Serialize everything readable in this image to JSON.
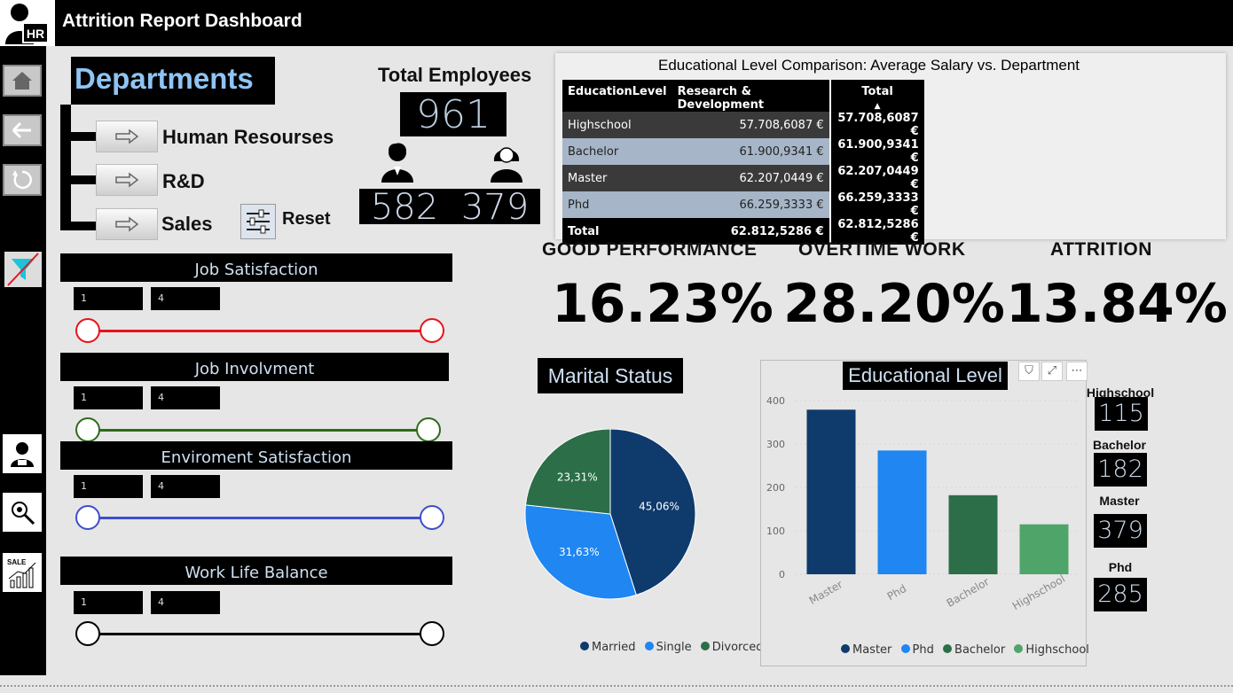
{
  "header": {
    "title": "Attrition Report Dashboard",
    "logo_text": "HR"
  },
  "nav": {
    "items": [
      "home-icon",
      "back-arrow-icon",
      "refresh-icon",
      "clear-filter-icon",
      "employee-icon",
      "hr-analysis-icon",
      "sales-chart-icon"
    ]
  },
  "departments": {
    "title": "Departments",
    "items": [
      "Human Resourses",
      "R&D",
      "Sales"
    ],
    "reset_label": "Reset"
  },
  "employees": {
    "title": "Total Employees",
    "total": "961",
    "male": "582",
    "female": "379"
  },
  "salary_table": {
    "title": "Educational Level Comparison: Average Salary vs. Department",
    "headers": [
      "EducationLevel",
      "Research & Development",
      "Total"
    ],
    "rows": [
      {
        "level": "Highschool",
        "rd": "57.708,6087 €",
        "total": "57.708,6087 €"
      },
      {
        "level": "Bachelor",
        "rd": "61.900,9341 €",
        "total": "61.900,9341 €"
      },
      {
        "level": "Master",
        "rd": "62.207,0449 €",
        "total": "62.207,0449 €"
      },
      {
        "level": "Phd",
        "rd": "66.259,3333 €",
        "total": "66.259,3333 €"
      }
    ],
    "total_row": {
      "label": "Total",
      "rd": "62.812,5286 €",
      "total": "62.812,5286 €"
    }
  },
  "kpis": [
    {
      "label": "GOOD PERFORMANCE",
      "value": "16.23%"
    },
    {
      "label": "OVERTIME WORK",
      "value": "28.20%"
    },
    {
      "label": "ATTRITION",
      "value": "13.84%"
    }
  ],
  "slicers": [
    {
      "title": "Job Satisfaction",
      "min": "1",
      "max": "4",
      "color": "#e8131b"
    },
    {
      "title": "Job Involvment",
      "min": "1",
      "max": "4",
      "color": "#2e6b1e"
    },
    {
      "title": "Enviroment Satisfaction",
      "min": "1",
      "max": "4",
      "color": "#3e4fc9"
    },
    {
      "title": "Work Life Balance",
      "min": "1",
      "max": "4",
      "color": "#000000"
    }
  ],
  "marital": {
    "title": "Marital Status",
    "legend": [
      "Married",
      "Single",
      "Divorced"
    ]
  },
  "education_chart": {
    "title": "Educational Level",
    "legend": [
      "Master",
      "Phd",
      "Bachelor",
      "Highschool"
    ]
  },
  "education_counts": [
    {
      "label": "Highschool",
      "value": "115"
    },
    {
      "label": "Bachelor",
      "value": "182"
    },
    {
      "label": "Master",
      "value": "379"
    },
    {
      "label": "Phd",
      "value": "285"
    }
  ],
  "chart_data": [
    {
      "type": "pie",
      "title": "Marital Status",
      "categories": [
        "Married",
        "Single",
        "Divorced"
      ],
      "values": [
        45.06,
        31.63,
        23.31
      ],
      "labels": [
        "45,06%",
        "31,63%",
        "23,31%"
      ],
      "colors": [
        "#0f3a6c",
        "#1f86f2",
        "#2b6e48"
      ],
      "legend": "bottom"
    },
    {
      "type": "bar",
      "title": "Educational Level",
      "categories": [
        "Master",
        "Phd",
        "Bachelor",
        "Highschool"
      ],
      "values": [
        379,
        285,
        182,
        115
      ],
      "colors": [
        "#0f3a6c",
        "#1f86f2",
        "#2b6e48",
        "#4fa46a"
      ],
      "ylim": [
        0,
        400
      ],
      "yticks": [
        0,
        100,
        200,
        300,
        400
      ],
      "legend": "bottom"
    }
  ]
}
